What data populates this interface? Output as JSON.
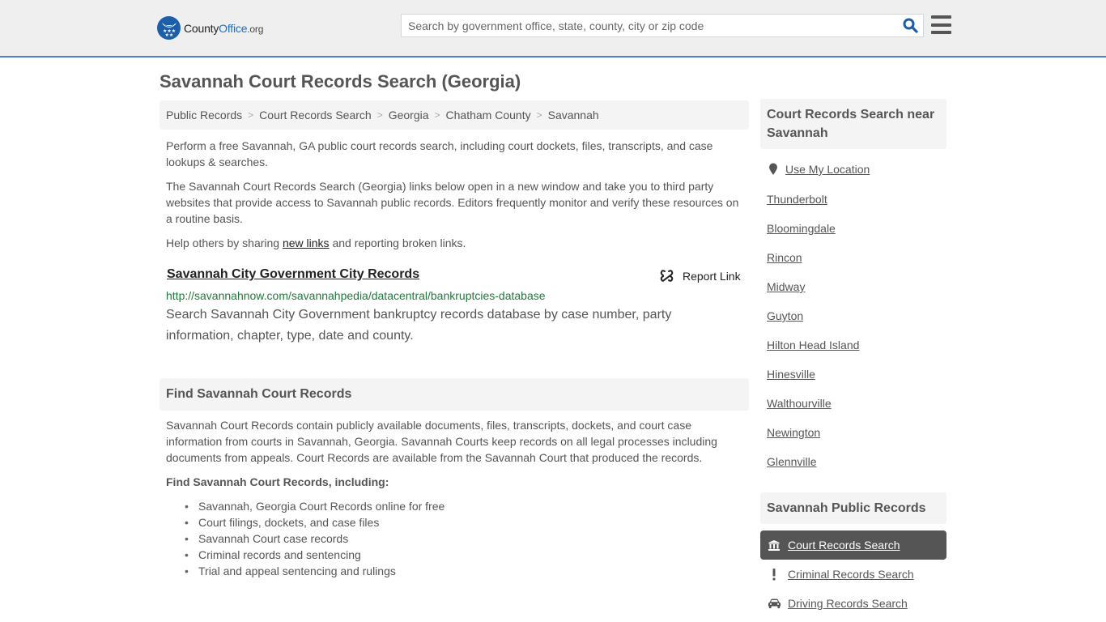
{
  "header": {
    "logo": {
      "county": "County",
      "office": "Office",
      "org": ".org"
    },
    "search": {
      "placeholder": "Search by government office, state, county, city or zip code",
      "value": ""
    },
    "brand_color": "#1c5ea8",
    "accent_border": "#4a86c5"
  },
  "page": {
    "title": "Savannah Court Records Search (Georgia)"
  },
  "breadcrumb": [
    {
      "label": "Public Records"
    },
    {
      "label": "Court Records Search"
    },
    {
      "label": "Georgia"
    },
    {
      "label": "Chatham County"
    },
    {
      "label": "Savannah"
    }
  ],
  "intro": {
    "p1": "Perform a free Savannah, GA public court records search, including court dockets, files, transcripts, and case lookups & searches.",
    "p2": "The Savannah Court Records Search (Georgia) links below open in a new window and take you to third party websites that provide access to Savannah public records. Editors frequently monitor and verify these resources on a routine basis.",
    "p3_before": "Help others by sharing ",
    "p3_link": "new links",
    "p3_after": " and reporting broken links."
  },
  "result": {
    "title": "Savannah City Government City Records",
    "report_label": "Report Link",
    "url": "http://savannahnow.com/savannahpedia/datacentral/bankruptcies-database",
    "description": "Search Savannah City Government bankruptcy records database by case number, party information, chapter, type, date and county.",
    "url_color": "#1f7a3c"
  },
  "find_section": {
    "header": "Find Savannah Court Records",
    "body": "Savannah Court Records contain publicly available documents, files, transcripts, dockets, and court case information from courts in Savannah, Georgia. Savannah Courts keep records on all legal processes including documents from appeals. Court Records are available from the Savannah Court that produced the records.",
    "subheading": "Find Savannah Court Records, including:",
    "bullets": [
      "Savannah, Georgia Court Records online for free",
      "Court filings, dockets, and case files",
      "Savannah Court case records",
      "Criminal records and sentencing",
      "Trial and appeal sentencing and rulings"
    ]
  },
  "sidebar": {
    "nearby_header": "Court Records Search near Savannah",
    "use_location": "Use My Location",
    "nearby": [
      "Thunderbolt",
      "Bloomingdale",
      "Rincon",
      "Midway",
      "Guyton",
      "Hilton Head Island",
      "Hinesville",
      "Walthourville",
      "Newington",
      "Glennville"
    ],
    "public_records_header": "Savannah Public Records",
    "public_records": [
      {
        "label": "Court Records Search",
        "icon": "courthouse-icon",
        "active": true
      },
      {
        "label": "Criminal Records Search",
        "icon": "exclamation-icon",
        "active": false
      },
      {
        "label": "Driving Records Search",
        "icon": "car-icon",
        "active": false
      }
    ]
  }
}
